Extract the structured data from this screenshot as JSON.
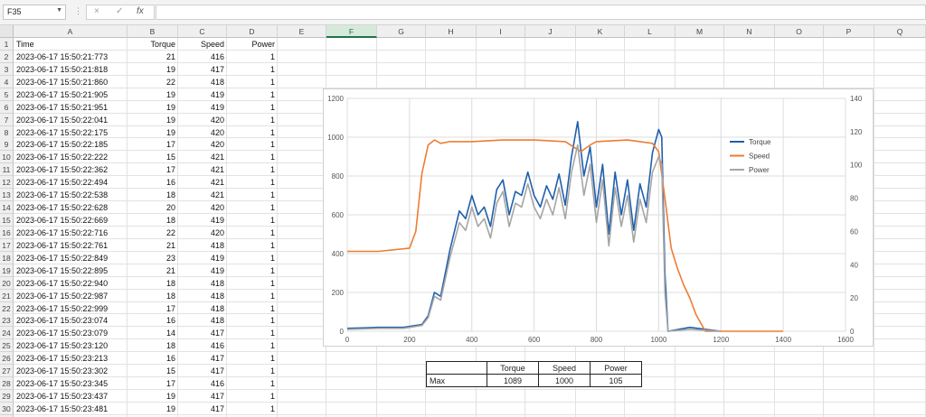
{
  "toolbar": {
    "name_box": "F35",
    "cancel_icon": "×",
    "enter_icon": "✓",
    "fx_label": "fx",
    "formula": ""
  },
  "columns": [
    "A",
    "B",
    "C",
    "D",
    "E",
    "F",
    "G",
    "H",
    "I",
    "J",
    "K",
    "L",
    "M",
    "N",
    "O",
    "P",
    "Q"
  ],
  "selected_column": "F",
  "headers": [
    "Time",
    "Torque",
    "Speed",
    "Power"
  ],
  "rows": [
    [
      "2023-06-17 15:50:21:773",
      "21",
      "416",
      "1"
    ],
    [
      "2023-06-17 15:50:21:818",
      "19",
      "417",
      "1"
    ],
    [
      "2023-06-17 15:50:21:860",
      "22",
      "418",
      "1"
    ],
    [
      "2023-06-17 15:50:21:905",
      "19",
      "419",
      "1"
    ],
    [
      "2023-06-17 15:50:21:951",
      "19",
      "419",
      "1"
    ],
    [
      "2023-06-17 15:50:22:041",
      "19",
      "420",
      "1"
    ],
    [
      "2023-06-17 15:50:22:175",
      "19",
      "420",
      "1"
    ],
    [
      "2023-06-17 15:50:22:185",
      "17",
      "420",
      "1"
    ],
    [
      "2023-06-17 15:50:22:222",
      "15",
      "421",
      "1"
    ],
    [
      "2023-06-17 15:50:22:362",
      "17",
      "421",
      "1"
    ],
    [
      "2023-06-17 15:50:22:494",
      "16",
      "421",
      "1"
    ],
    [
      "2023-06-17 15:50:22:538",
      "18",
      "421",
      "1"
    ],
    [
      "2023-06-17 15:50:22:628",
      "20",
      "420",
      "1"
    ],
    [
      "2023-06-17 15:50:22:669",
      "18",
      "419",
      "1"
    ],
    [
      "2023-06-17 15:50:22:716",
      "22",
      "420",
      "1"
    ],
    [
      "2023-06-17 15:50:22:761",
      "21",
      "418",
      "1"
    ],
    [
      "2023-06-17 15:50:22:849",
      "23",
      "419",
      "1"
    ],
    [
      "2023-06-17 15:50:22:895",
      "21",
      "419",
      "1"
    ],
    [
      "2023-06-17 15:50:22:940",
      "18",
      "418",
      "1"
    ],
    [
      "2023-06-17 15:50:22:987",
      "18",
      "418",
      "1"
    ],
    [
      "2023-06-17 15:50:22:999",
      "17",
      "418",
      "1"
    ],
    [
      "2023-06-17 15:50:23:074",
      "16",
      "418",
      "1"
    ],
    [
      "2023-06-17 15:50:23:079",
      "14",
      "417",
      "1"
    ],
    [
      "2023-06-17 15:50:23:120",
      "18",
      "416",
      "1"
    ],
    [
      "2023-06-17 15:50:23:213",
      "16",
      "417",
      "1"
    ],
    [
      "2023-06-17 15:50:23:302",
      "15",
      "417",
      "1"
    ],
    [
      "2023-06-17 15:50:23:345",
      "17",
      "416",
      "1"
    ],
    [
      "2023-06-17 15:50:23:437",
      "19",
      "417",
      "1"
    ],
    [
      "2023-06-17 15:50:23:481",
      "19",
      "417",
      "1"
    ]
  ],
  "max_table": {
    "headers": [
      "Torque",
      "Speed",
      "Power"
    ],
    "label": "Max",
    "values": [
      "1089",
      "1000",
      "105"
    ]
  },
  "chart_data": {
    "type": "line",
    "title": "",
    "xlim": [
      0,
      1600
    ],
    "ylim_left": [
      0,
      1200
    ],
    "ylim_right": [
      0,
      140
    ],
    "x_ticks": [
      0,
      200,
      400,
      600,
      800,
      1000,
      1200,
      1400,
      1600
    ],
    "y_left_ticks": [
      0,
      200,
      400,
      600,
      800,
      1000,
      1200
    ],
    "y_right_ticks": [
      0,
      20,
      40,
      60,
      80,
      100,
      120,
      140
    ],
    "grid": true,
    "legend_position": "right",
    "series": [
      {
        "name": "Torque",
        "axis": "left",
        "color": "#1f5fad",
        "x": [
          0,
          100,
          180,
          240,
          260,
          280,
          300,
          330,
          360,
          380,
          400,
          420,
          440,
          460,
          480,
          500,
          520,
          540,
          560,
          580,
          600,
          620,
          640,
          660,
          680,
          700,
          720,
          740,
          760,
          780,
          800,
          820,
          840,
          860,
          880,
          900,
          920,
          940,
          960,
          980,
          1000,
          1010,
          1020,
          1030,
          1100,
          1200
        ],
        "y": [
          15,
          20,
          20,
          35,
          80,
          200,
          180,
          420,
          620,
          580,
          700,
          600,
          640,
          540,
          730,
          780,
          600,
          720,
          700,
          820,
          700,
          640,
          750,
          680,
          810,
          650,
          900,
          1080,
          800,
          950,
          640,
          860,
          500,
          820,
          600,
          780,
          520,
          760,
          640,
          920,
          1040,
          1000,
          300,
          0,
          20,
          0
        ]
      },
      {
        "name": "Speed",
        "axis": "right",
        "color": "#ed7d31",
        "x": [
          0,
          100,
          200,
          220,
          240,
          260,
          280,
          300,
          330,
          400,
          500,
          600,
          700,
          750,
          780,
          800,
          900,
          980,
          1000,
          1020,
          1040,
          1060,
          1080,
          1100,
          1120,
          1150,
          1300,
          1400
        ],
        "y": [
          48,
          48,
          50,
          60,
          95,
          112,
          115,
          113,
          114,
          114,
          115,
          115,
          114,
          108,
          112,
          114,
          115,
          113,
          108,
          80,
          50,
          38,
          28,
          20,
          10,
          0,
          0,
          0
        ]
      },
      {
        "name": "Power",
        "axis": "left",
        "color": "#a5a5a5",
        "x": [
          0,
          100,
          180,
          240,
          260,
          280,
          300,
          330,
          360,
          380,
          400,
          420,
          440,
          460,
          480,
          500,
          520,
          540,
          560,
          580,
          600,
          620,
          640,
          660,
          680,
          700,
          720,
          740,
          760,
          780,
          800,
          820,
          840,
          860,
          880,
          900,
          920,
          940,
          960,
          980,
          1000,
          1010,
          1020,
          1030,
          1100,
          1200
        ],
        "y": [
          10,
          15,
          15,
          30,
          70,
          180,
          160,
          380,
          560,
          520,
          640,
          540,
          580,
          480,
          660,
          720,
          540,
          660,
          640,
          760,
          640,
          580,
          680,
          600,
          740,
          580,
          820,
          960,
          700,
          860,
          560,
          780,
          440,
          740,
          540,
          700,
          460,
          680,
          560,
          820,
          900,
          860,
          200,
          0,
          10,
          0
        ]
      }
    ]
  }
}
